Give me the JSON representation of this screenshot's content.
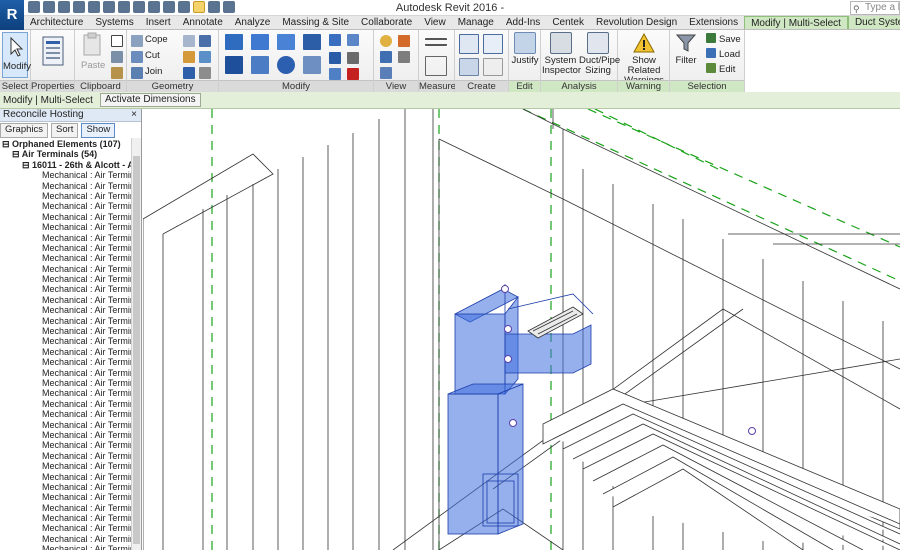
{
  "app": {
    "logo": "R",
    "title": "Autodesk Revit 2016 -",
    "search_placeholder": "Type a keyword"
  },
  "quick_access_icons": [
    "open-icon",
    "save-icon",
    "sync-icon",
    "undo-icon",
    "redo-icon",
    "print-icon",
    "measure-icon",
    "dimension-icon",
    "text-icon",
    "3d-view-icon",
    "section-icon",
    "thin-lines-icon",
    "close-hidden-icon",
    "switch-windows-icon"
  ],
  "tabs": [
    {
      "label": "Architecture"
    },
    {
      "label": "Systems"
    },
    {
      "label": "Insert"
    },
    {
      "label": "Annotate"
    },
    {
      "label": "Analyze"
    },
    {
      "label": "Massing & Site"
    },
    {
      "label": "Collaborate"
    },
    {
      "label": "View"
    },
    {
      "label": "Manage"
    },
    {
      "label": "Add-Ins"
    },
    {
      "label": "Centek"
    },
    {
      "label": "Revolution Design"
    },
    {
      "label": "Extensions"
    },
    {
      "label": "Modify | Multi-Select"
    },
    {
      "label": "Duct Systems"
    }
  ],
  "ribbon": {
    "select": {
      "button": "Modify",
      "title": "Select ▾"
    },
    "properties": {
      "title": "Properties"
    },
    "clipboard": {
      "paste": "Paste",
      "title": "Clipboard"
    },
    "geometry": {
      "cope": "Cope",
      "cut": "Cut",
      "join": "Join",
      "title": "Geometry"
    },
    "modify": {
      "title": "Modify"
    },
    "view": {
      "title": "View"
    },
    "measure": {
      "title": "Measure"
    },
    "create": {
      "title": "Create"
    },
    "edit": {
      "justify": "Justify",
      "title": "Edit"
    },
    "analysis": {
      "system_inspector_1": "System",
      "system_inspector_2": "Inspector",
      "duct_sizing_1": "Duct/Pipe",
      "duct_sizing_2": "Sizing",
      "title": "Analysis"
    },
    "warning": {
      "show_related_1": "Show Related",
      "show_related_2": "Warnings",
      "title": "Warning"
    },
    "selection": {
      "filter": "Filter",
      "save": "Save",
      "load": "Load",
      "edit": "Edit",
      "title": "Selection"
    }
  },
  "options_bar": {
    "context": "Modify | Multi-Select",
    "activate_dimensions": "Activate Dimensions"
  },
  "left_panel": {
    "title": "Reconcile Hosting",
    "close": "×",
    "buttons": {
      "graphics": "Graphics",
      "sort": "Sort",
      "show": "Show"
    },
    "tree_root": "Orphaned Elements (107)",
    "tree_group": "Air Terminals (54)",
    "tree_host": "16011 - 26th & Alcott - A",
    "tree_item": "Mechanical : Air Terminal"
  },
  "colors": {
    "ribbon_bg": "#f2f2f2",
    "context_tab": "#cfe7c3",
    "duct_fill": "#3f6fe0",
    "duct_stroke": "#1c3da8",
    "grid_green": "#1aa31a"
  }
}
